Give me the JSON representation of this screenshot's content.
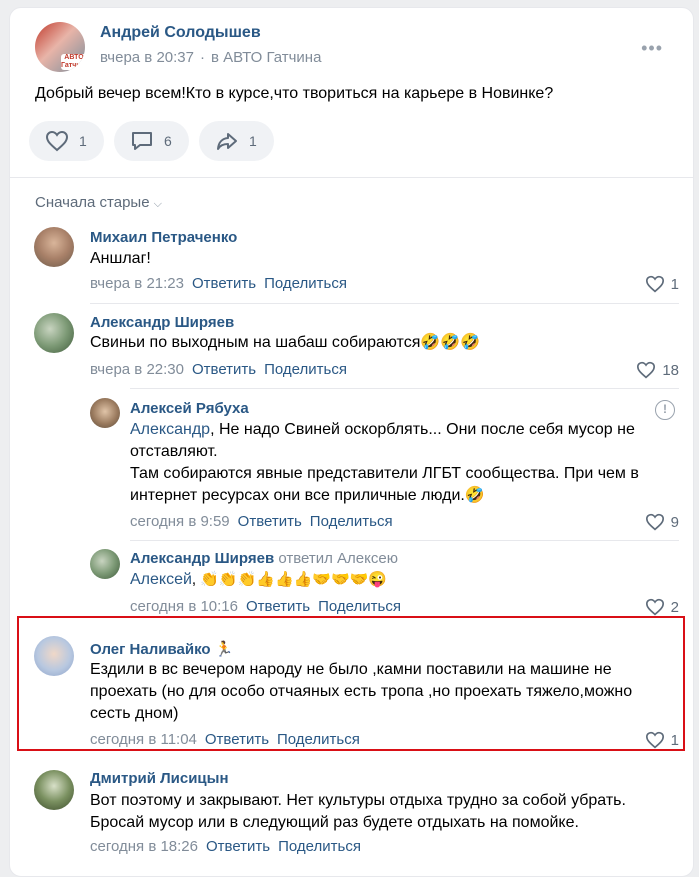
{
  "post": {
    "author": "Андрей Солодышев",
    "time": "вчера в 20:37",
    "group": "в АВТО Гатчина",
    "avatar_badge": "АВТО Гатчина",
    "text": "Добрый вечер всем!Кто в курсе,что твориться на карьере в Новинке?",
    "likes": "1",
    "comments": "6",
    "shares": "1",
    "more_icon": "•••"
  },
  "sort_label": "Сначала старые",
  "comments": [
    {
      "author": "Михаил Петраченко",
      "text": "Аншлаг!",
      "time": "вчера в 21:23",
      "reply": "Ответить",
      "share": "Поделиться",
      "likes": "1"
    },
    {
      "author": "Александр Ширяев",
      "text": "Свиньи по выходным на шабаш собираются🤣🤣🤣",
      "time": "вчера в 22:30",
      "reply": "Ответить",
      "share": "Поделиться",
      "likes": "18",
      "replies": [
        {
          "author": "Алексей Рябуха",
          "mention": "Александр",
          "lines": [
            ", Не надо Свиней оскорблять... Они после себя мусор не",
            "отставляют.",
            "Там собираются явные представители ЛГБТ сообщества. При чем в",
            "интернет ресурсах они все приличные люди.🤣"
          ],
          "time": "сегодня в 9:59",
          "reply": "Ответить",
          "share": "Поделиться",
          "likes": "9",
          "warn": "!"
        },
        {
          "author": "Александр Ширяев",
          "replied_to": "ответил Алексею",
          "mention": "Алексей",
          "text": ", 👏👏👏👍👍👍🤝🤝🤝😜",
          "time": "сегодня в 10:16",
          "reply": "Ответить",
          "share": "Поделиться",
          "likes": "2"
        }
      ]
    },
    {
      "author": "Олег Наливайко 🏃",
      "lines": [
        "Ездили в вс вечером народу не было ,камни поставили на машине не",
        "проехать (но для особо отчаяных есть тропа ,но проехать тяжело,можно",
        "сесть дном)"
      ],
      "time": "сегодня в 11:04",
      "reply": "Ответить",
      "share": "Поделиться",
      "likes": "1"
    },
    {
      "author": "Дмитрий Лисицын",
      "lines": [
        "Вот поэтому и закрывают. Нет культуры отдыха трудно за собой убрать.",
        "Бросай мусор или в следующий раз будете отдыхать на помойке."
      ],
      "time": "сегодня в 18:26",
      "reply": "Ответить",
      "share": "Поделиться"
    }
  ]
}
